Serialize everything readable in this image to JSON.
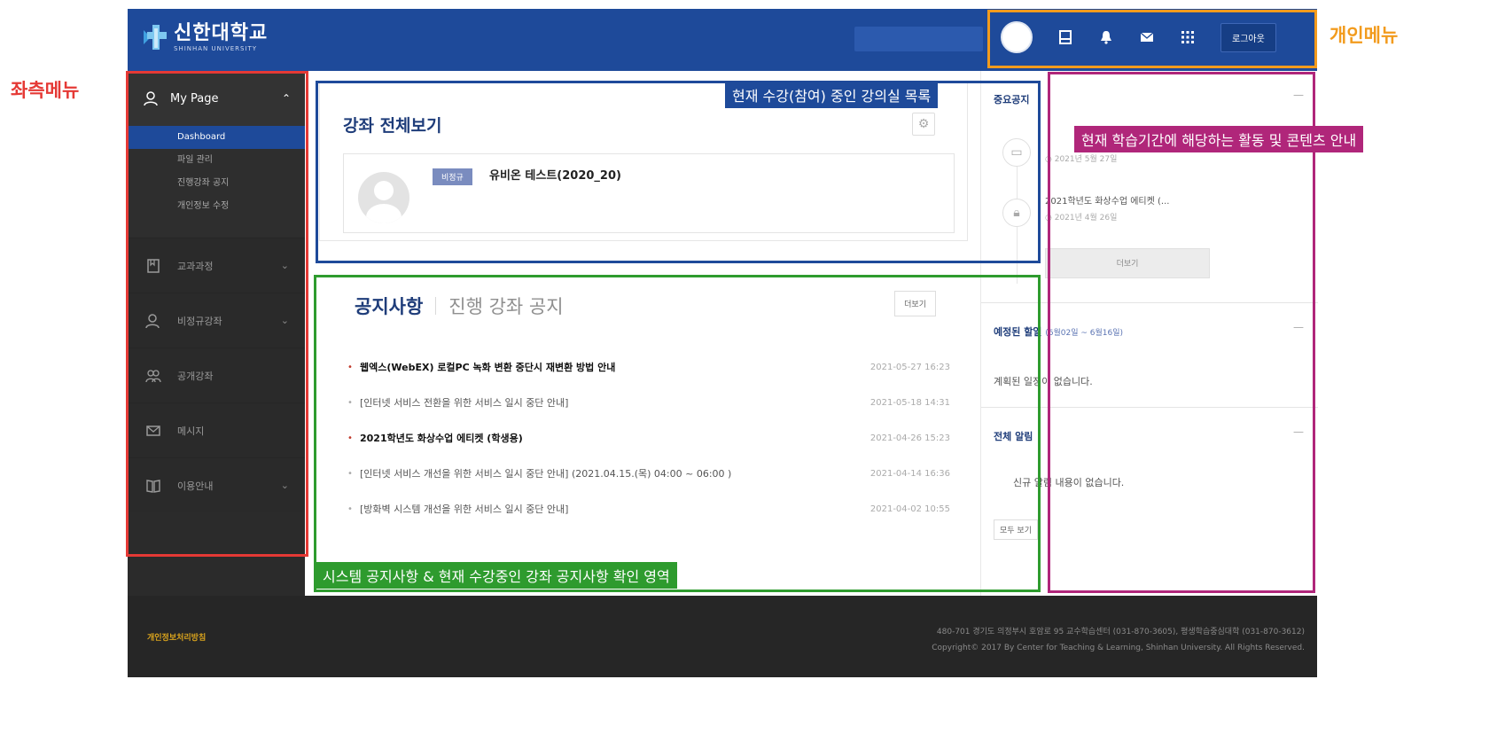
{
  "colors": {
    "topbar": "#1e4a9a",
    "sidebar": "#2b2b2b",
    "accent": "#1f3d7a",
    "annotation_red": "#e53935",
    "annotation_orange": "#f29b1d",
    "annotation_blue": "#1e4a9a",
    "annotation_green": "#2e9b2e",
    "annotation_purple": "#b0267a"
  },
  "header": {
    "logo_text": "신한대학교",
    "logo_sub": "SHINHAN UNIVERSITY",
    "logout_label": "로그아웃",
    "icons": [
      "avatar",
      "dashboard-icon",
      "bell-icon",
      "mail-icon",
      "apps-icon"
    ]
  },
  "sidebar": {
    "mypage_label": "My Page",
    "sub_items": [
      "Dashboard",
      "파일 관리",
      "진행강좌 공지",
      "개인정보 수정"
    ],
    "menu": [
      {
        "label": "교과과정",
        "icon": "book-icon",
        "expandable": true
      },
      {
        "label": "비정규강좌",
        "icon": "person-icon",
        "expandable": true
      },
      {
        "label": "공개강좌",
        "icon": "people-icon",
        "expandable": false
      },
      {
        "label": "메시지",
        "icon": "mail-icon",
        "expandable": false
      },
      {
        "label": "이용안내",
        "icon": "guide-icon",
        "expandable": true
      }
    ]
  },
  "course": {
    "title": "강좌 전체보기",
    "badge": "비정규",
    "name": "유비온 테스트(2020_20)"
  },
  "notices": {
    "tab_active": "공지사항",
    "tab_inactive": "진행 강좌 공지",
    "more_label": "더보기",
    "items": [
      {
        "title": "웹엑스(WebEX) 로컬PC 녹화 변환 중단시 재변환 방법 안내",
        "date": "2021-05-27 16:23",
        "bold": true
      },
      {
        "title": "[인터넷 서비스 전환을 위한 서비스 일시 중단 안내]",
        "date": "2021-05-18 14:31",
        "bold": false
      },
      {
        "title": "2021학년도 화상수업 에티켓 (학생용)",
        "date": "2021-04-26 15:23",
        "bold": true
      },
      {
        "title": "[인터넷 서비스 개선을 위한 서비스 일시 중단 안내] (2021.04.15.(목) 04:00 ~ 06:00 )",
        "date": "2021-04-14 16:36",
        "bold": false
      },
      {
        "title": "[방화벽 시스템 개선을 위한 서비스 일시 중단 안내]",
        "date": "2021-04-02 10:55",
        "bold": false
      }
    ]
  },
  "right": {
    "important_title": "중요공지",
    "timeline": [
      {
        "title": "",
        "date": "2021년 5월 27일",
        "icon": "doc-icon"
      },
      {
        "title": "2021학년도 화상수업 에티켓 (...",
        "date": "2021년 4월 26일",
        "icon": "lock-icon"
      }
    ],
    "more_label": "더보기",
    "schedule_title": "예정된 할일",
    "schedule_range": "(6월02일 ~ 6월16일)",
    "schedule_empty": "계획된 일정이 없습니다.",
    "alerts_title": "전체 알림",
    "alerts_empty": "신규 알림 내용이 없습니다.",
    "view_all_label": "모두 보기",
    "dash": "—"
  },
  "footer": {
    "privacy": "개인정보처리방침",
    "address": "480-701 경기도 의정부시 호암로 95 교수학습센터 (031-870-3605), 평생학습중심대학 (031-870-3612)",
    "copyright": "Copyright© 2017 By Center for Teaching & Learning, Shinhan University. All Rights Reserved."
  },
  "annotations": {
    "left_menu": "좌측메뉴",
    "personal_menu": "개인메뉴",
    "course_list": "현재 수강(참여) 중인 강의실 목록",
    "activity_guide": "현재 학습기간에 해당하는 활동 및 콘텐츠 안내",
    "notice_area": "시스템 공지사항 & 현재 수강중인 강좌 공지사항 확인 영역"
  }
}
